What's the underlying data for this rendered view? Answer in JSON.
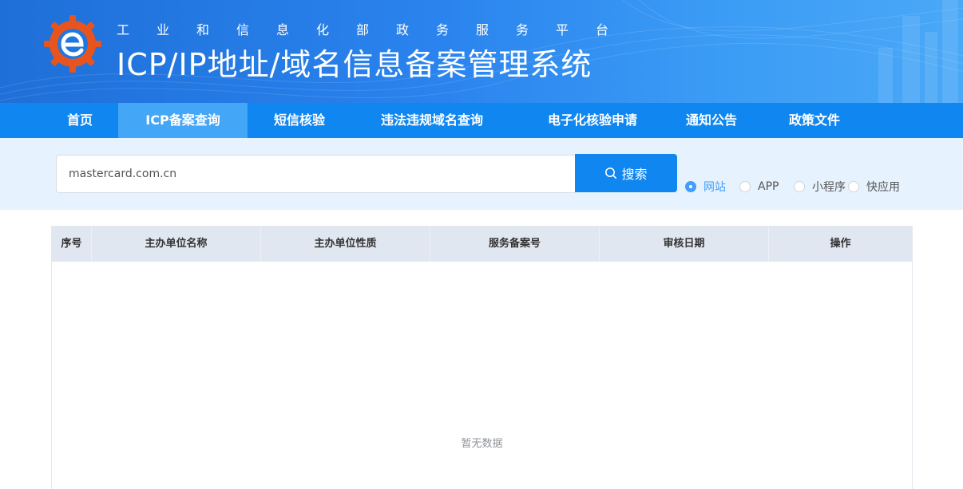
{
  "header": {
    "subtitle": "工业和信息化部政务服务平台",
    "title": "ICP/IP地址/域名信息备案管理系统",
    "logo_icon": "miit-gear-e-logo-icon"
  },
  "nav": {
    "items": [
      {
        "label": "首页",
        "active": false
      },
      {
        "label": "ICP备案查询",
        "active": true
      },
      {
        "label": "短信核验",
        "active": false
      },
      {
        "label": "违法违规域名查询",
        "active": false
      },
      {
        "label": "电子化核验申请",
        "active": false
      },
      {
        "label": "通知公告",
        "active": false
      },
      {
        "label": "政策文件",
        "active": false
      }
    ]
  },
  "search": {
    "value": "mastercard.com.cn",
    "button_label": "搜索",
    "button_icon": "search-icon",
    "options": [
      {
        "label": "网站",
        "checked": true
      },
      {
        "label": "APP",
        "checked": false
      },
      {
        "label": "小程序",
        "checked": false
      },
      {
        "label": "快应用",
        "checked": false
      }
    ]
  },
  "table": {
    "columns": [
      "序号",
      "主办单位名称",
      "主办单位性质",
      "服务备案号",
      "审核日期",
      "操作"
    ],
    "rows": [],
    "empty_text": "暂无数据"
  },
  "colors": {
    "nav_bg": "#0f86f0",
    "nav_active": "#44a6f6",
    "search_zone_bg": "#e6f2fd",
    "radio_checked": "#409eff",
    "table_header_bg": "#e1e7f0"
  }
}
